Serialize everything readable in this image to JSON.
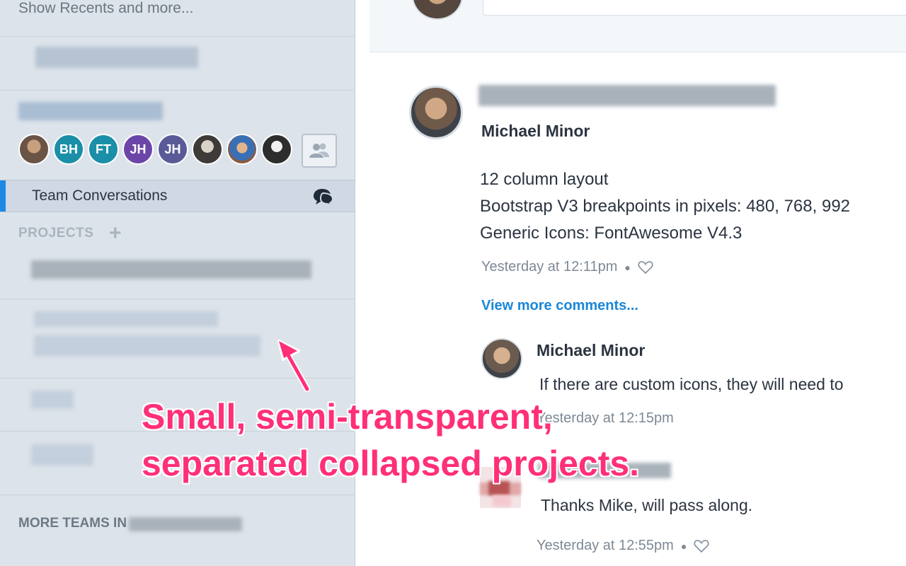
{
  "sidebar": {
    "show_recents": "Show Recents and more...",
    "team_avatars": [
      {
        "kind": "photo",
        "initials": ""
      },
      {
        "kind": "initials",
        "initials": "BH",
        "color": "#1b8fa8"
      },
      {
        "kind": "initials",
        "initials": "FT",
        "color": "#1b8fa8"
      },
      {
        "kind": "initials",
        "initials": "JH",
        "color": "#6b46a8"
      },
      {
        "kind": "initials",
        "initials": "JH",
        "color": "#5b5a98"
      },
      {
        "kind": "photo",
        "initials": ""
      },
      {
        "kind": "photo",
        "initials": ""
      },
      {
        "kind": "photo",
        "initials": ""
      }
    ],
    "team_conversations": "Team Conversations",
    "projects_label": "PROJECTS",
    "add_project": "+",
    "more_teams_label": "MORE TEAMS IN",
    "accent_color": "#1e88e5"
  },
  "post": {
    "author": "Michael Minor",
    "lines": [
      "12 column layout",
      "Bootstrap V3 breakpoints in pixels: 480, 768, 992",
      "Generic Icons: FontAwesome V4.3"
    ],
    "timestamp": "Yesterday at 12:11pm",
    "view_more": "View more comments..."
  },
  "comments": [
    {
      "author": "Michael Minor",
      "text": "If there are custom icons, they will need to",
      "timestamp": "Yesterday at 12:15pm"
    },
    {
      "author": "",
      "text": "Thanks Mike, will pass along.",
      "timestamp": "Yesterday at 12:55pm"
    }
  ],
  "annotation": {
    "line1": "Small, semi-transparent,",
    "line2": "separated collapsed projects.",
    "color": "#ff2f78"
  }
}
